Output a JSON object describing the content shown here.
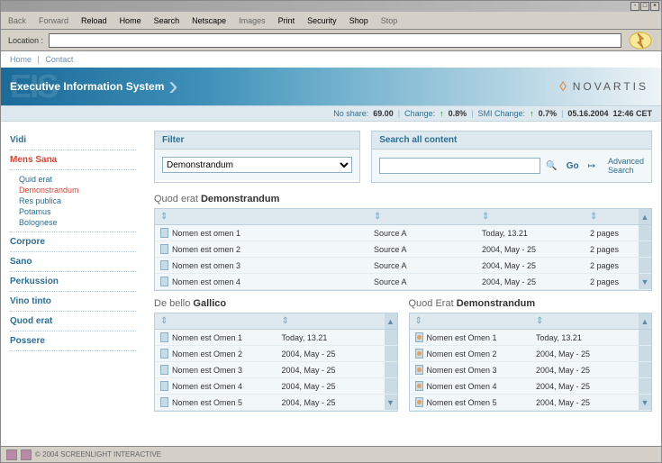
{
  "toolbar": {
    "back": "Back",
    "forward": "Forward",
    "reload": "Reload",
    "home": "Home",
    "search": "Search",
    "netscape": "Netscape",
    "images": "Images",
    "print": "Print",
    "security": "Security",
    "shop": "Shop",
    "stop": "Stop"
  },
  "location_label": "Location :",
  "top_links": {
    "home": "Home",
    "contact": "Contact"
  },
  "banner": {
    "ghost": "EIS",
    "title": "Executive Information System",
    "logo": "NOVARTIS"
  },
  "ticker": {
    "label1": "No share:",
    "val1": "69.00",
    "label2": "Change:",
    "val2": "0.8%",
    "label3": "SMI Change:",
    "val3": "0.7%",
    "date": "05.16.2004",
    "time": "12:46 CET"
  },
  "nav": {
    "vidi": "Vidi",
    "mens": "Mens Sana",
    "mens_sub": [
      "Quid erat",
      "Demonstrandum",
      "Res publica",
      "Potamus",
      "Bolognese"
    ],
    "corpore": "Corpore",
    "sano": "Sano",
    "perkussion": "Perkussion",
    "vino": "Vino tinto",
    "quod": "Quod erat",
    "possere": "Possere"
  },
  "filter": {
    "head": "Filter",
    "value": "Demonstrandum"
  },
  "search": {
    "head": "Search all content",
    "go": "Go",
    "adv": "Advanced Search",
    "arrow": "↦"
  },
  "section1": {
    "pre": "Quod erat ",
    "bold": "Demonstrandum"
  },
  "table1": {
    "rows": [
      {
        "n": "Nomen est omen 1",
        "s": "Source A",
        "d": "Today, 13.21",
        "p": "2 pages"
      },
      {
        "n": "Nomen est omen 2",
        "s": "Source A",
        "d": "2004, May - 25",
        "p": "2 pages"
      },
      {
        "n": "Nomen est omen 3",
        "s": "Source A",
        "d": "2004, May - 25",
        "p": "2 pages"
      },
      {
        "n": "Nomen est omen 4",
        "s": "Source A",
        "d": "2004, May - 25",
        "p": "2 pages"
      }
    ]
  },
  "section2": {
    "pre": "De bello ",
    "bold": "Gallico"
  },
  "table2": {
    "rows": [
      {
        "n": "Nomen est Omen 1",
        "d": "Today, 13.21"
      },
      {
        "n": "Nomen est Omen 2",
        "d": "2004, May - 25"
      },
      {
        "n": "Nomen est Omen 3",
        "d": "2004, May - 25"
      },
      {
        "n": "Nomen est Omen 4",
        "d": "2004, May - 25"
      },
      {
        "n": "Nomen est Omen 5",
        "d": "2004, May - 25"
      }
    ]
  },
  "section3": {
    "pre": "Quod Erat ",
    "bold": "Demonstrandum"
  },
  "table3": {
    "rows": [
      {
        "n": "Nomen est Omen 1",
        "d": "Today, 13.21"
      },
      {
        "n": "Nomen est Omen 2",
        "d": "2004, May - 25"
      },
      {
        "n": "Nomen est Omen 3",
        "d": "2004, May - 25"
      },
      {
        "n": "Nomen est Omen 4",
        "d": "2004, May - 25"
      },
      {
        "n": "Nomen est Omen 5",
        "d": "2004, May - 25"
      }
    ]
  },
  "status": {
    "copy": "© 2004 SCREENLIGHT INTERACTIVE"
  }
}
